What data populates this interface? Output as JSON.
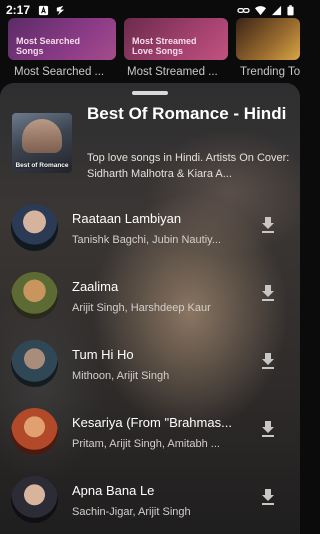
{
  "status_bar": {
    "time": "2:17",
    "notification_icons": [
      "a-square-icon",
      "bolt-icon"
    ],
    "system_icons": [
      "link-icon",
      "wifi-icon",
      "signal-icon",
      "battery-icon"
    ]
  },
  "background": {
    "cards": [
      {
        "label": "Most Searched Songs",
        "caption": "Most Searched ..."
      },
      {
        "label": "Most Streamed Love Songs",
        "caption": "Most Streamed ..."
      },
      {
        "label": "",
        "caption": "Trending To"
      }
    ]
  },
  "playlist": {
    "cover_caption": "Best of Romance",
    "title": "Best Of Romance - Hindi",
    "description": "Top love songs in Hindi. Artists On Cover: Sidharth Malhotra & Kiara A..."
  },
  "songs": [
    {
      "title": "Raataan Lambiyan",
      "artists": "Tanishk Bagchi, Jubin Nautiy...",
      "icon": "download-icon"
    },
    {
      "title": "Zaalima",
      "artists": "Arijit Singh, Harshdeep Kaur",
      "icon": "download-icon"
    },
    {
      "title": "Tum Hi Ho",
      "artists": "Mithoon, Arijit Singh",
      "icon": "download-icon"
    },
    {
      "title": "Kesariya (From \"Brahmas...",
      "artists": "Pritam, Arijit Singh, Amitabh ...",
      "icon": "download-icon"
    },
    {
      "title": "Apna Bana Le",
      "artists": "Sachin-Jigar, Arijit Singh",
      "icon": "download-icon"
    }
  ],
  "colors": {
    "sheet_bg": "#2e2e30",
    "card1": "#8a3b86",
    "card2": "#a3416f",
    "card3": "#9a6b2f"
  }
}
